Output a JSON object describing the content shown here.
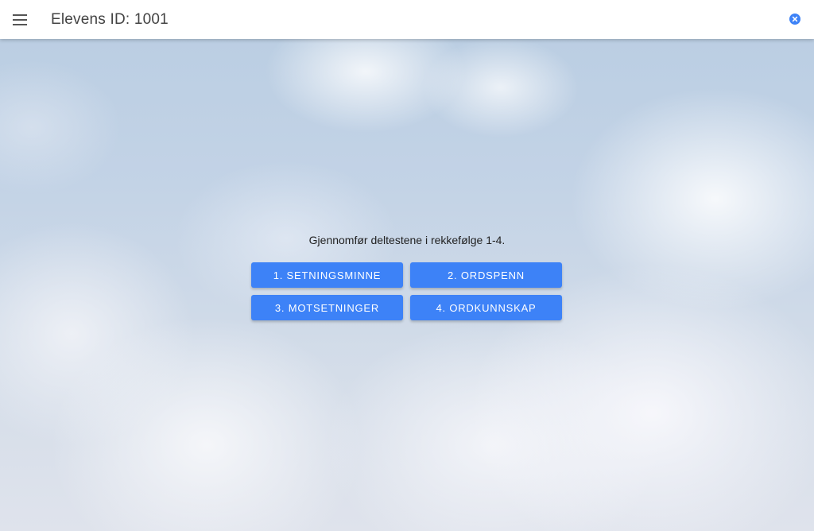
{
  "header": {
    "title": "Elevens ID: 1001",
    "menu_icon": "hamburger-menu-icon",
    "close_icon": "close-circle-icon"
  },
  "main": {
    "instruction": "Gjennomfør deltestene i rekkefølge 1-4.",
    "tests": [
      {
        "label": "1. SETNINGSMINNE"
      },
      {
        "label": "2. ORDSPENN"
      },
      {
        "label": "3. MOTSETNINGER"
      },
      {
        "label": "4. ORDKUNNSKAP"
      }
    ]
  },
  "colors": {
    "accent": "#3d82f7",
    "appbar_bg": "#ffffff",
    "title_text": "#444444"
  }
}
